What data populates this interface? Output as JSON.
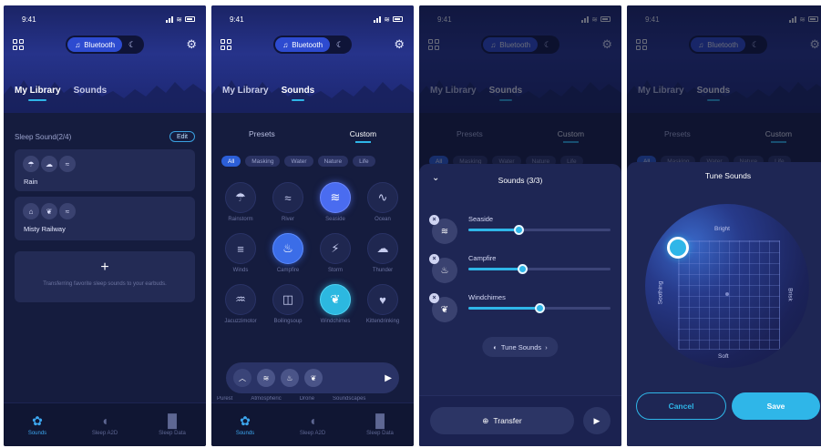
{
  "status": {
    "time": "9:41"
  },
  "topbar": {
    "bluetooth_label": "Bluetooth",
    "bluetooth_icon": "music-note-icon",
    "moon_icon": "moon-icon",
    "settings_icon": "gear-icon"
  },
  "main_tabs": [
    "My Library",
    "Sounds"
  ],
  "bottom_nav": [
    "Sounds",
    "Sleep A2D",
    "Sleep Data"
  ],
  "library": {
    "section_title": "Sleep Sound(2/4)",
    "edit_label": "Edit",
    "mixes": [
      {
        "name": "Rain",
        "icons": [
          "cloud-rain-icon",
          "cloud-rain-icon",
          "wind-icon"
        ]
      },
      {
        "name": "Misty Railway",
        "icons": [
          "train-icon",
          "leaf-icon",
          "wind-icon"
        ]
      }
    ],
    "add_hint": "Transferring favorite sleep sounds to your earbuds."
  },
  "sounds": {
    "segments": [
      "Presets",
      "Custom"
    ],
    "filters": [
      "All",
      "Masking",
      "Water",
      "Nature",
      "Life"
    ],
    "items": [
      {
        "name": "Rainstorm",
        "icon": "rainstorm-icon",
        "state": ""
      },
      {
        "name": "River",
        "icon": "river-icon",
        "state": ""
      },
      {
        "name": "Seaside",
        "icon": "seaside-icon",
        "state": "sel-blue"
      },
      {
        "name": "Ocean",
        "icon": "ocean-icon",
        "state": ""
      },
      {
        "name": "Winds",
        "icon": "wind-icon",
        "state": ""
      },
      {
        "name": "Campfire",
        "icon": "campfire-icon",
        "state": "sel-orange"
      },
      {
        "name": "Storm",
        "icon": "storm-icon",
        "state": ""
      },
      {
        "name": "Thunder",
        "icon": "thunder-icon",
        "state": ""
      },
      {
        "name": "Jacuzzimotor",
        "icon": "jacuzzi-icon",
        "state": ""
      },
      {
        "name": "Boilingsoup",
        "icon": "pot-icon",
        "state": ""
      },
      {
        "name": "Windchimes",
        "icon": "windchimes-icon",
        "state": "sel-cyan"
      },
      {
        "name": "Kittendrinking",
        "icon": "kitten-icon",
        "state": ""
      }
    ],
    "under_labels": [
      "Purest",
      "Atmospheric",
      "Drone",
      "Soundscapes"
    ]
  },
  "mixer": {
    "title": "Sounds (3/3)",
    "items": [
      {
        "name": "Seaside",
        "icon": "seaside-icon",
        "level": 0.35
      },
      {
        "name": "Campfire",
        "icon": "campfire-icon",
        "level": 0.38
      },
      {
        "name": "Windchimes",
        "icon": "windchimes-icon",
        "level": 0.5
      }
    ],
    "tune_label": "Tune Sounds",
    "transfer_label": "Transfer"
  },
  "tune": {
    "title": "Tune Sounds",
    "axes": {
      "top": "Bright",
      "bottom": "Soft",
      "left": "Soothing",
      "right": "Brisk"
    },
    "cancel_label": "Cancel",
    "save_label": "Save"
  },
  "colors": {
    "accent": "#2fb6e8",
    "bluetooth_pill": "#2d4bd0",
    "background": "#141b3a",
    "card": "#232b55"
  }
}
